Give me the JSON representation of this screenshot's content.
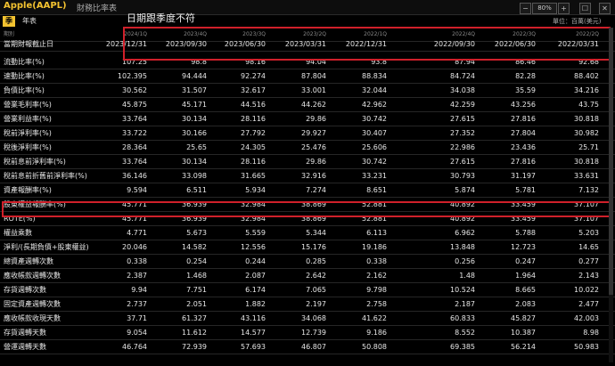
{
  "window": {
    "title": "Apple(AAPL)",
    "subtitle": "財務比率表",
    "zoom": "80%",
    "controls": [
      "−",
      "+",
      "☐",
      "✕"
    ]
  },
  "tabs": [
    {
      "label": "季",
      "active": true
    },
    {
      "label": "年表",
      "active": false
    }
  ],
  "annotation": "日期跟季度不符",
  "unit": "單位：百萬(美元)",
  "table": {
    "quarter_label": "期別",
    "quarters": [
      "2024/1Q",
      "2023/4Q",
      "2023/3Q",
      "2023/2Q",
      "2022/1Q",
      "2022/4Q",
      "2022/3Q",
      "2022/2Q"
    ],
    "date_label": "當期財報截止日",
    "dates": [
      "2023/12/31",
      "2023/09/30",
      "2023/06/30",
      "2023/03/31",
      "2022/12/31",
      "2022/09/30",
      "2022/06/30",
      "2022/03/31"
    ],
    "rows": [
      {
        "label": "流動比率(%)",
        "values": [
          "107.25",
          "98.8",
          "98.16",
          "94.04",
          "93.8",
          "87.94",
          "86.46",
          "92.68"
        ]
      },
      {
        "label": "速動比率(%)",
        "values": [
          "102.395",
          "94.444",
          "92.274",
          "87.804",
          "88.834",
          "84.724",
          "82.28",
          "88.402"
        ]
      },
      {
        "label": "負債比率(%)",
        "values": [
          "30.562",
          "31.507",
          "32.617",
          "33.001",
          "32.044",
          "34.038",
          "35.59",
          "34.216"
        ]
      },
      {
        "label": "營業毛利率(%)",
        "values": [
          "45.875",
          "45.171",
          "44.516",
          "44.262",
          "42.962",
          "42.259",
          "43.256",
          "43.75"
        ]
      },
      {
        "label": "營業利益率(%)",
        "values": [
          "33.764",
          "30.134",
          "28.116",
          "29.86",
          "30.742",
          "27.615",
          "27.816",
          "30.818"
        ]
      },
      {
        "label": "稅前淨利率(%)",
        "values": [
          "33.722",
          "30.166",
          "27.792",
          "29.927",
          "30.407",
          "27.352",
          "27.804",
          "30.982"
        ]
      },
      {
        "label": "稅後淨利率(%)",
        "values": [
          "28.364",
          "25.65",
          "24.305",
          "25.476",
          "25.606",
          "22.986",
          "23.436",
          "25.71"
        ]
      },
      {
        "label": "稅前息前淨利率(%)",
        "values": [
          "33.764",
          "30.134",
          "28.116",
          "29.86",
          "30.742",
          "27.615",
          "27.816",
          "30.818"
        ]
      },
      {
        "label": "稅前息前折舊前淨利率(%)",
        "values": [
          "36.146",
          "33.098",
          "31.665",
          "32.916",
          "33.231",
          "30.793",
          "31.197",
          "33.631"
        ]
      },
      {
        "label": "資產報酬率(%)",
        "values": [
          "9.594",
          "6.511",
          "5.934",
          "7.274",
          "8.651",
          "5.874",
          "5.781",
          "7.132"
        ]
      },
      {
        "label": "股東權益報酬率(%)",
        "values": [
          "45.771",
          "36.939",
          "32.984",
          "38.869",
          "52.881",
          "40.892",
          "33.459",
          "37.107"
        ]
      },
      {
        "label": "ROTE(%)",
        "values": [
          "45.771",
          "36.939",
          "32.984",
          "38.869",
          "52.881",
          "40.892",
          "33.459",
          "37.107"
        ]
      },
      {
        "label": "權益乘數",
        "values": [
          "4.771",
          "5.673",
          "5.559",
          "5.344",
          "6.113",
          "6.962",
          "5.788",
          "5.203"
        ]
      },
      {
        "label": "淨利/(長期負債+股東權益)",
        "values": [
          "20.046",
          "14.582",
          "12.556",
          "15.176",
          "19.186",
          "13.848",
          "12.723",
          "14.65"
        ]
      },
      {
        "label": "總資產週轉次數",
        "values": [
          "0.338",
          "0.254",
          "0.244",
          "0.285",
          "0.338",
          "0.256",
          "0.247",
          "0.277"
        ]
      },
      {
        "label": "應收帳款週轉次數",
        "values": [
          "2.387",
          "1.468",
          "2.087",
          "2.642",
          "2.162",
          "1.48",
          "1.964",
          "2.143"
        ]
      },
      {
        "label": "存貨週轉次數",
        "values": [
          "9.94",
          "7.751",
          "6.174",
          "7.065",
          "9.798",
          "10.524",
          "8.665",
          "10.022"
        ]
      },
      {
        "label": "固定資產週轉次數",
        "values": [
          "2.737",
          "2.051",
          "1.882",
          "2.197",
          "2.758",
          "2.187",
          "2.083",
          "2.477"
        ]
      },
      {
        "label": "應收帳款收現天數",
        "values": [
          "37.71",
          "61.327",
          "43.116",
          "34.068",
          "41.622",
          "60.833",
          "45.827",
          "42.003"
        ]
      },
      {
        "label": "存貨週轉天數",
        "values": [
          "9.054",
          "11.612",
          "14.577",
          "12.739",
          "9.186",
          "8.552",
          "10.387",
          "8.98"
        ]
      },
      {
        "label": "營運週轉天數",
        "values": [
          "46.764",
          "72.939",
          "57.693",
          "46.807",
          "50.808",
          "69.385",
          "56.214",
          "50.983"
        ]
      }
    ]
  }
}
